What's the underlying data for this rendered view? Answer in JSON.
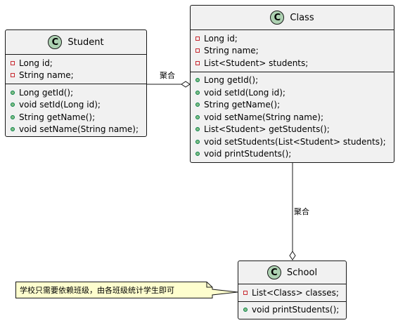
{
  "classes": {
    "student": {
      "badge": "C",
      "name": "Student",
      "fields": [
        "Long id;",
        "String name;"
      ],
      "methods": [
        "Long getId();",
        "void setId(Long id);",
        "String getName();",
        "void setName(String name);"
      ]
    },
    "class": {
      "badge": "C",
      "name": "Class",
      "fields": [
        "Long id;",
        "String name;",
        "List<Student> students;"
      ],
      "methods": [
        "Long getId();",
        "void setId(Long id);",
        "String getName();",
        "void setName(String name);",
        "List<Student> getStudents();",
        "void setStudents(List<Student> students);",
        "void printStudents();"
      ]
    },
    "school": {
      "badge": "C",
      "name": "School",
      "fields": [
        "List<Class> classes;"
      ],
      "methods": [
        "void printStudents();"
      ]
    }
  },
  "relations": {
    "student_class_label": "聚合",
    "class_school_label": "聚合"
  },
  "note": {
    "text": "学校只需要依赖班级，由各班级统计学生即可"
  },
  "colors": {
    "class_bg": "#f1f1f1",
    "badge_bg": "#add1b2",
    "note_bg": "#fefece",
    "private_marker": "#c82930",
    "public_marker": "#84be84"
  }
}
